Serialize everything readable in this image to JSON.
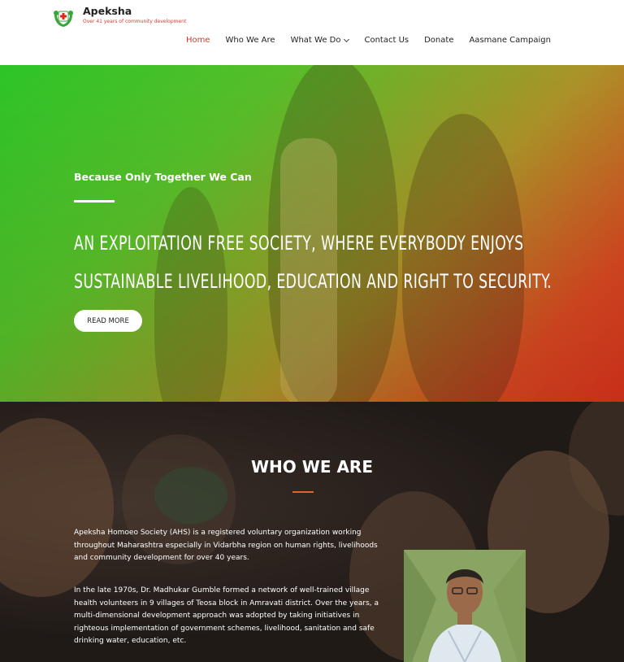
{
  "brand": {
    "name": "Apeksha",
    "tagline": "Over 41 years of community development",
    "colors": {
      "accent": "#d93a2b",
      "green": "#3aa53a",
      "orange": "#e2632c"
    },
    "logo_icon": "cross-hands-icon"
  },
  "nav": {
    "items": [
      {
        "label": "Home",
        "active": true
      },
      {
        "label": "Who We Are"
      },
      {
        "label": "What We Do",
        "has_dropdown": true
      },
      {
        "label": "Contact Us"
      },
      {
        "label": "Donate"
      },
      {
        "label": "Aasmane Campaign"
      }
    ]
  },
  "hero": {
    "subtitle": "Because Only Together We Can",
    "title_line1": "AN EXPLOITATION FREE SOCIETY, WHERE EVERYBODY ENJOYS",
    "title_line2": "SUSTAINABLE LIVELIHOOD, EDUCATION AND RIGHT TO SECURITY.",
    "button": "READ MORE"
  },
  "who": {
    "title": "WHO WE ARE",
    "para1": "Apeksha Homoeo Society (AHS) is a registered voluntary organization working throughout Maharashtra especially in Vidarbha region on human rights, livelihoods and community development for over 40 years.",
    "para2": "In the late 1970s, Dr. Madhukar Gumble formed a network of well-trained village health volunteers in 9 villages of Teosa block in Amravati district. Over the years,  a multi-dimensional development approach was adopted by taking initiatives in righteous implementation of government schemes, livelihood, sanitation and safe drinking water, education, etc."
  }
}
